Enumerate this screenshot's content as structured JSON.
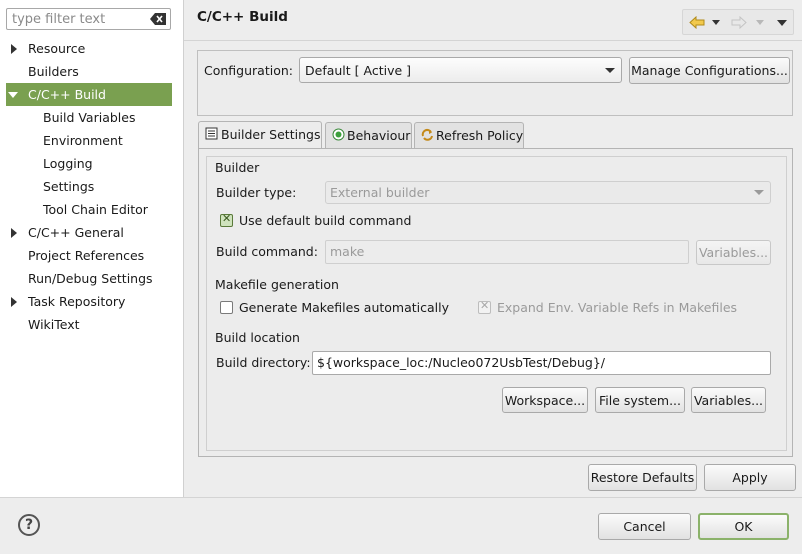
{
  "filter": {
    "placeholder": "type filter text"
  },
  "tree": {
    "items": [
      {
        "label": "Resource"
      },
      {
        "label": "Builders"
      },
      {
        "label": "C/C++ Build"
      },
      {
        "label": "Build Variables"
      },
      {
        "label": "Environment"
      },
      {
        "label": "Logging"
      },
      {
        "label": "Settings"
      },
      {
        "label": "Tool Chain Editor"
      },
      {
        "label": "C/C++ General"
      },
      {
        "label": "Project References"
      },
      {
        "label": "Run/Debug Settings"
      },
      {
        "label": "Task Repository"
      },
      {
        "label": "WikiText"
      }
    ]
  },
  "header": {
    "title": "C/C++ Build"
  },
  "config": {
    "label": "Configuration:",
    "value": "Default  [ Active ]",
    "manage_button": "Manage Configurations..."
  },
  "tabs": [
    {
      "label": "Builder Settings"
    },
    {
      "label": "Behaviour"
    },
    {
      "label": "Refresh Policy"
    }
  ],
  "builder": {
    "section": "Builder",
    "type_label": "Builder type:",
    "type_value": "External builder",
    "use_default_label": "Use default build command",
    "command_label": "Build command:",
    "command_value": "make",
    "variables_button": "Variables..."
  },
  "makefile": {
    "section": "Makefile generation",
    "generate_label": "Generate Makefiles automatically",
    "expand_label": "Expand Env. Variable Refs in Makefiles"
  },
  "location": {
    "section": "Build location",
    "dir_label": "Build directory:",
    "dir_value": "${workspace_loc:/Nucleo072UsbTest/Debug}/",
    "workspace_button": "Workspace...",
    "filesystem_button": "File system...",
    "variables_button": "Variables..."
  },
  "footer": {
    "restore_button": "Restore Defaults",
    "apply_button": "Apply",
    "cancel_button": "Cancel",
    "ok_button": "OK"
  },
  "colors": {
    "selection": "#7aa050",
    "default_button_border": "#8bb26a"
  }
}
